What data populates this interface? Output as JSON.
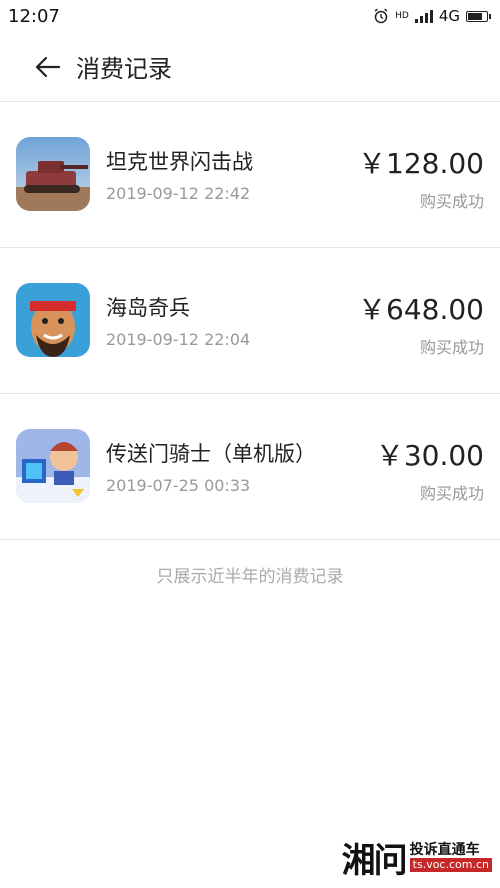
{
  "status_bar": {
    "time": "12:07",
    "network": "4G",
    "hd": "HD"
  },
  "header": {
    "title": "消费记录"
  },
  "records": [
    {
      "app_name": "坦克世界闪击战",
      "time": "2019-09-12 22:42",
      "price": "￥128.00",
      "status": "购买成功",
      "icon": "tank-game-icon"
    },
    {
      "app_name": "海岛奇兵",
      "time": "2019-09-12 22:04",
      "price": "￥648.00",
      "status": "购买成功",
      "icon": "boom-beach-icon"
    },
    {
      "app_name": "传送门骑士（单机版）",
      "time": "2019-07-25 00:33",
      "price": "￥30.00",
      "status": "购买成功",
      "icon": "portal-knights-icon"
    }
  ],
  "footer_note": "只展示近半年的消费记录",
  "watermark": {
    "logo": "湘问",
    "line1": "投诉直通车",
    "line2": "ts.voc.com.cn"
  }
}
